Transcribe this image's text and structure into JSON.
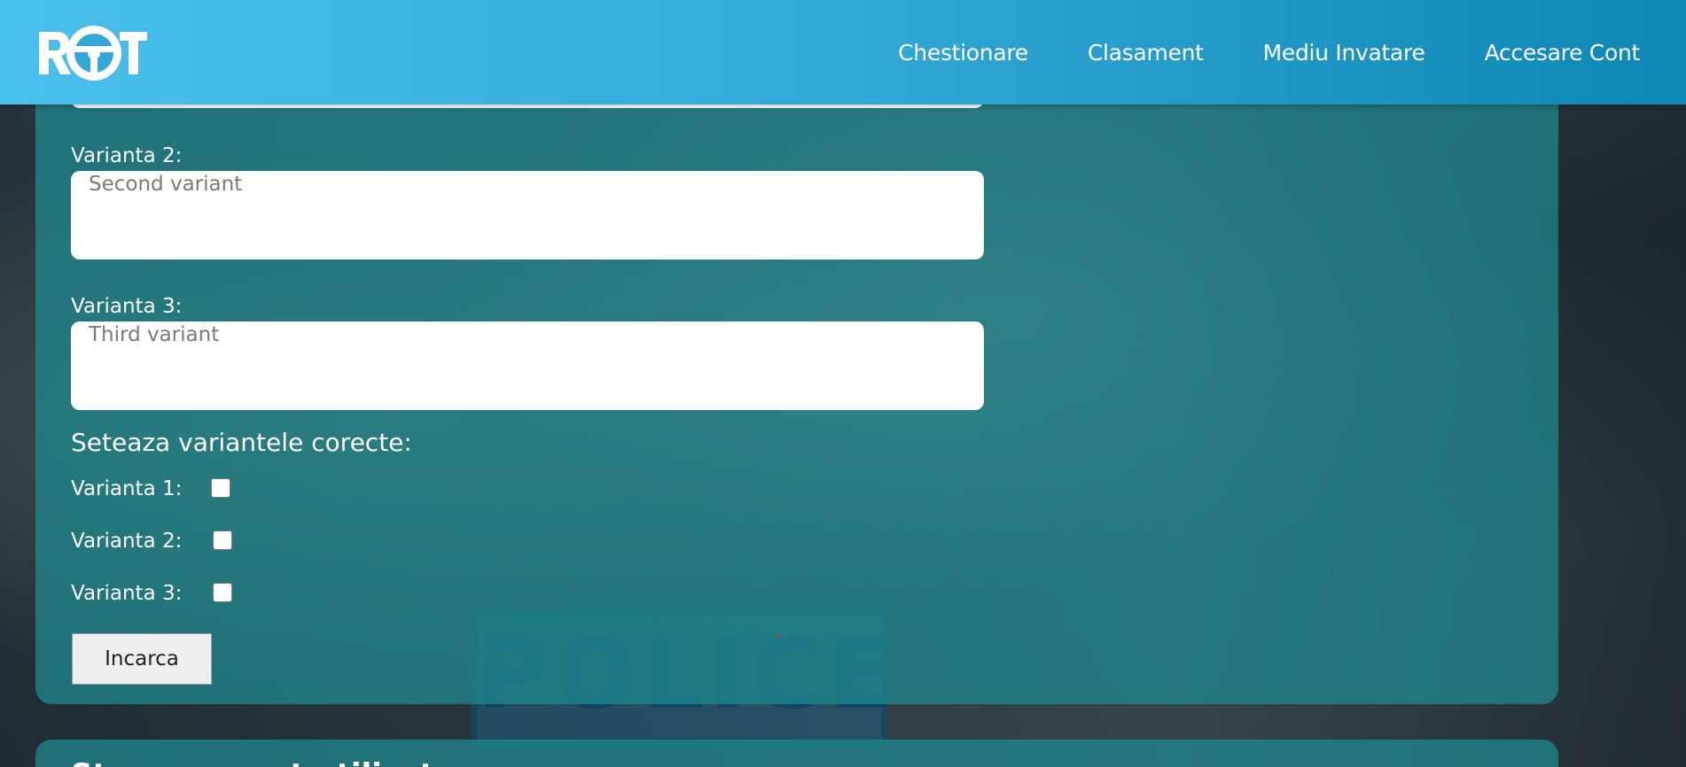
{
  "site": {
    "logo_text": "ROT",
    "brand_colors": {
      "header_start": "#4cc0ec",
      "header_end": "#0e87b4",
      "card": "#1e8c91"
    }
  },
  "nav": {
    "items": [
      {
        "label": "Chestionare"
      },
      {
        "label": "Clasament"
      },
      {
        "label": "Mediu Invatare"
      },
      {
        "label": "Accesare Cont"
      }
    ]
  },
  "form": {
    "variant2": {
      "label": "Varianta 2:",
      "placeholder": "Second variant"
    },
    "variant3": {
      "label": "Varianta 3:",
      "placeholder": "Third variant"
    },
    "correct_title": "Seteaza variantele corecte:",
    "checks": [
      {
        "label": "Varianta 1:",
        "checked": false
      },
      {
        "label": "Varianta 2:",
        "checked": false
      },
      {
        "label": "Varianta 3:",
        "checked": false
      }
    ],
    "submit_label": "Incarca"
  },
  "next_section": {
    "title": "Stergere cont utilizator"
  },
  "background": {
    "sign_text": "POLICE"
  }
}
